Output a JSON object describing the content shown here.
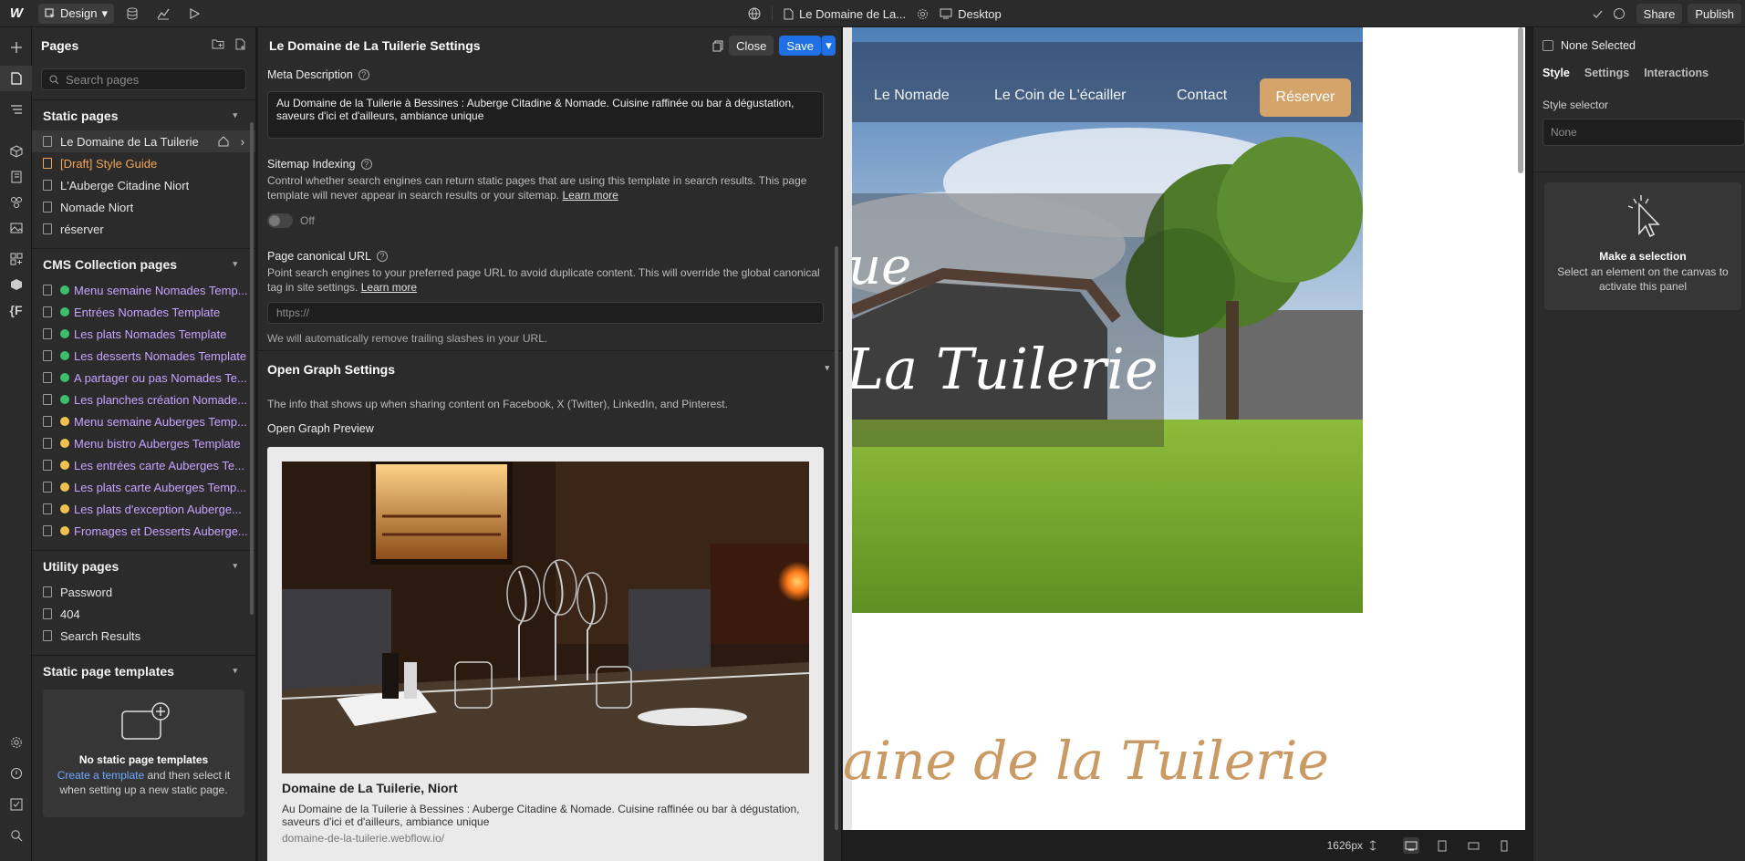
{
  "topbar": {
    "mode_label": "Design",
    "page_name": "Le Domaine de La...",
    "breakpoint_label": "Desktop",
    "share_label": "Share",
    "publish_label": "Publish"
  },
  "pages_panel": {
    "title": "Pages",
    "search_placeholder": "Search pages",
    "static_section": "Static pages",
    "static_pages": [
      {
        "label": "Le Domaine de La Tuilerie"
      },
      {
        "label": "[Draft] Style Guide"
      },
      {
        "label": "L'Auberge Citadine Niort"
      },
      {
        "label": "Nomade Niort"
      },
      {
        "label": "réserver"
      }
    ],
    "cms_section": "CMS Collection pages",
    "cms_pages": [
      {
        "label": "Menu semaine Nomades Temp...",
        "dot": "#3dbf6a"
      },
      {
        "label": "Entrées Nomades Template",
        "dot": "#3dbf6a"
      },
      {
        "label": "Les plats Nomades Template",
        "dot": "#3dbf6a"
      },
      {
        "label": "Les desserts Nomades Template",
        "dot": "#3dbf6a"
      },
      {
        "label": "A partager ou pas Nomades Te...",
        "dot": "#3dbf6a"
      },
      {
        "label": "Les planches création Nomade...",
        "dot": "#3dbf6a"
      },
      {
        "label": "Menu semaine Auberges Temp...",
        "dot": "#f2c14e"
      },
      {
        "label": "Menu bistro Auberges Template",
        "dot": "#f2c14e"
      },
      {
        "label": "Les entrées carte Auberges Te...",
        "dot": "#f2c14e"
      },
      {
        "label": "Les plats carte Auberges Temp...",
        "dot": "#f2c14e"
      },
      {
        "label": "Les plats d'exception Auberge...",
        "dot": "#f2c14e"
      },
      {
        "label": "Fromages et Desserts Auberge...",
        "dot": "#f2c14e"
      }
    ],
    "utility_section": "Utility pages",
    "utility_pages": [
      {
        "label": "Password"
      },
      {
        "label": "404"
      },
      {
        "label": "Search Results"
      }
    ],
    "templates_section": "Static page templates",
    "templates_empty_title": "No static page templates",
    "templates_empty_link": "Create a template",
    "templates_empty_text": " and then select it when setting up a new static page."
  },
  "settings": {
    "title": "Le Domaine de La Tuilerie Settings",
    "close_label": "Close",
    "save_label": "Save",
    "meta_label": "Meta Description",
    "meta_value": "Au Domaine de la Tuilerie à Bessines : Auberge Citadine & Nomade. Cuisine raffinée ou bar à dégustation, saveurs d'ici et d'ailleurs, ambiance unique",
    "sitemap_label": "Sitemap Indexing",
    "sitemap_help": "Control whether search engines can return static pages that are using this template in search results. This page template will never appear in search results or your sitemap. ",
    "learn_more": "Learn more",
    "sitemap_state": "Off",
    "canonical_label": "Page canonical URL",
    "canonical_help": "Point search engines to your preferred page URL to avoid duplicate content. This will override the global canonical tag in site settings. ",
    "canonical_placeholder": "https://",
    "canonical_note": "We will automatically remove trailing slashes in your URL.",
    "og_section": "Open Graph Settings",
    "og_help": "The info that shows up when sharing content on Facebook, X (Twitter), LinkedIn, and Pinterest.",
    "og_preview_label": "Open Graph Preview",
    "og_title": "Domaine de La Tuilerie, Niort",
    "og_desc": "Au Domaine de la Tuilerie à Bessines : Auberge Citadine & Nomade. Cuisine raffinée ou bar à dégustation, saveurs d'ici et d'ailleurs, ambiance unique",
    "og_url": "domaine-de-la-tuilerie.webflow.io/"
  },
  "canvas": {
    "nav": [
      "Le Nomade",
      "Le Coin de L'écailler",
      "Contact"
    ],
    "cta": "Réserver",
    "hero_line1": "ue",
    "hero_line2": "La Tuilerie",
    "big_title": "aine de la Tuilerie",
    "width_readout": "1626px"
  },
  "right_panel": {
    "selection": "None Selected",
    "tabs": [
      "Style",
      "Settings",
      "Interactions"
    ],
    "style_selector_label": "Style selector",
    "style_selector_value": "None",
    "empty_title": "Make a selection",
    "empty_text": "Select an element on the canvas to activate this panel"
  },
  "colors": {
    "accent": "#1f6fe5",
    "cta": "#d5a46b",
    "title_gold": "#c99a63",
    "cms_text": "#c6a4ff",
    "draft_text": "#f2a65a"
  }
}
